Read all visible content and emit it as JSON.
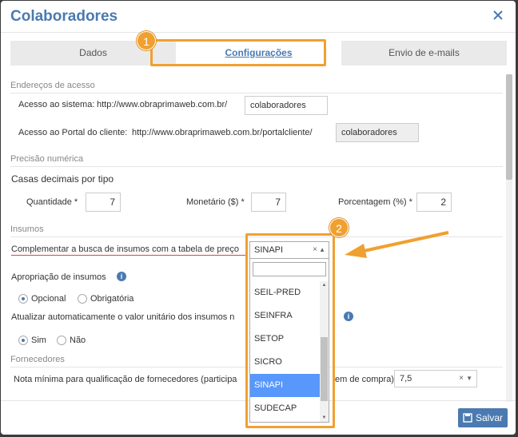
{
  "dialog": {
    "title": "Colaboradores"
  },
  "tabs": [
    {
      "label": "Dados"
    },
    {
      "label": "Configurações"
    },
    {
      "label": "Envio de e-mails"
    }
  ],
  "badges": {
    "one": "1",
    "two": "2"
  },
  "enderecos": {
    "title": "Endereços de acesso",
    "sistema_label": "Acesso ao sistema:",
    "sistema_url": "http://www.obraprimaweb.com.br/",
    "sistema_value": "colaboradores",
    "portal_label": "Acesso ao Portal do cliente:",
    "portal_url": "http://www.obraprimaweb.com.br/portalcliente/",
    "portal_value": "colaboradores"
  },
  "precisao": {
    "title": "Precisão numérica",
    "subtitle": "Casas decimais por tipo",
    "quantidade_label": "Quantidade *",
    "quantidade_value": "7",
    "monetario_label": "Monetário ($) *",
    "monetario_value": "7",
    "porcentagem_label": "Porcentagem (%) *",
    "porcentagem_value": "2"
  },
  "insumos": {
    "title": "Insumos",
    "complementar_label": "Complementar a busca de insumos com a tabela de preço",
    "select_value": "SINAPI",
    "apropriacao_label": "Apropriação de insumos",
    "opcional": "Opcional",
    "obrigatoria": "Obrigatória",
    "atualizar_label": "Atualizar automaticamente o valor unitário dos insumos n",
    "sim": "Sim",
    "nao": "Não"
  },
  "dropdown": {
    "items": [
      "SEIL-PRED",
      "SEINFRA",
      "SETOP",
      "SICRO",
      "SINAPI",
      "SUDECAP"
    ],
    "selected": "SINAPI"
  },
  "fornecedores": {
    "title": "Fornecedores",
    "nota_label_a": "Nota mínima para qualificação de fornecedores (participa",
    "nota_label_b": "em de compra)",
    "nota_value": "7,5"
  },
  "footer": {
    "save_label": "Salvar"
  },
  "colors": {
    "accent": "#4a7ab0",
    "highlight": "#f0a030",
    "selected": "#5897fb"
  }
}
